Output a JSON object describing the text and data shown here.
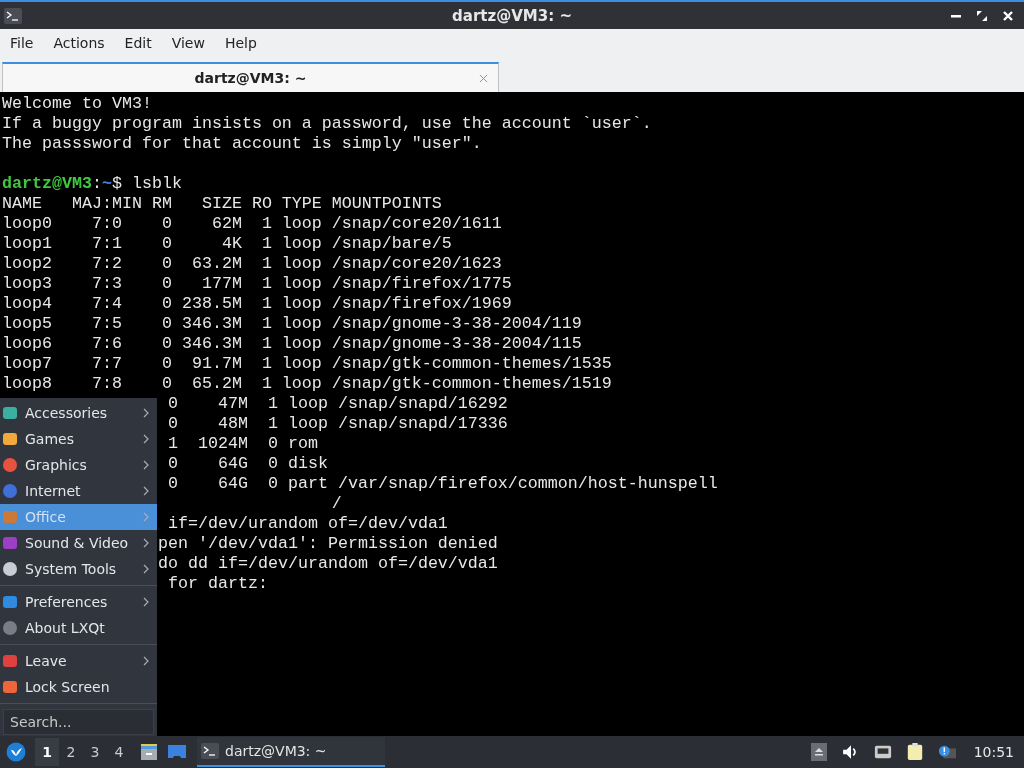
{
  "window": {
    "title": "dartz@VM3: ~"
  },
  "menubar": [
    "File",
    "Actions",
    "Edit",
    "View",
    "Help"
  ],
  "tabs": [
    {
      "label": "dartz@VM3: ~",
      "selected": true
    }
  ],
  "terminal": {
    "lines": [
      {
        "kind": "text",
        "text": "Welcome to VM3!"
      },
      {
        "kind": "text",
        "text": "If a buggy program insists on a password, use the account `user`."
      },
      {
        "kind": "text",
        "text": "The passsword for that account is simply \"user\"."
      },
      {
        "kind": "blank"
      },
      {
        "kind": "prompt",
        "user": "dartz@VM3",
        "separator": ":",
        "path": "~",
        "symbol": "$",
        "command": "lsblk"
      },
      {
        "kind": "text",
        "text": "NAME   MAJ:MIN RM   SIZE RO TYPE MOUNTPOINTS"
      },
      {
        "kind": "text",
        "text": "loop0    7:0    0    62M  1 loop /snap/core20/1611"
      },
      {
        "kind": "text",
        "text": "loop1    7:1    0     4K  1 loop /snap/bare/5"
      },
      {
        "kind": "text",
        "text": "loop2    7:2    0  63.2M  1 loop /snap/core20/1623"
      },
      {
        "kind": "text",
        "text": "loop3    7:3    0   177M  1 loop /snap/firefox/1775"
      },
      {
        "kind": "text",
        "text": "loop4    7:4    0 238.5M  1 loop /snap/firefox/1969"
      },
      {
        "kind": "text",
        "text": "loop5    7:5    0 346.3M  1 loop /snap/gnome-3-38-2004/119"
      },
      {
        "kind": "text",
        "text": "loop6    7:6    0 346.3M  1 loop /snap/gnome-3-38-2004/115"
      },
      {
        "kind": "text",
        "text": "loop7    7:7    0  91.7M  1 loop /snap/gtk-common-themes/1535"
      },
      {
        "kind": "text",
        "text": "loop8    7:8    0  65.2M  1 loop /snap/gtk-common-themes/1519"
      },
      {
        "kind": "covered",
        "text": " 0    47M  1 loop /snap/snapd/16292"
      },
      {
        "kind": "covered",
        "text": " 0    48M  1 loop /snap/snapd/17336"
      },
      {
        "kind": "covered",
        "text": " 1  1024M  0 rom"
      },
      {
        "kind": "covered",
        "text": " 0    64G  0 disk"
      },
      {
        "kind": "covered",
        "text": " 0    64G  0 part /var/snap/firefox/common/host-hunspell"
      },
      {
        "kind": "text",
        "text": "                                 /"
      },
      {
        "kind": "covered",
        "text": " if=/dev/urandom of=/dev/vda1"
      },
      {
        "kind": "covered",
        "text": "pen '/dev/vda1': Permission denied"
      },
      {
        "kind": "covered",
        "text": "do dd if=/dev/urandom of=/dev/vda1"
      },
      {
        "kind": "covered",
        "text": " for dartz:"
      }
    ]
  },
  "app_menu": {
    "sections": [
      {
        "items": [
          {
            "label": "Accessories",
            "submenu": true,
            "selected": false
          },
          {
            "label": "Games",
            "submenu": true,
            "selected": false
          },
          {
            "label": "Graphics",
            "submenu": true,
            "selected": false
          },
          {
            "label": "Internet",
            "submenu": true,
            "selected": false
          },
          {
            "label": "Office",
            "submenu": true,
            "selected": true
          },
          {
            "label": "Sound & Video",
            "submenu": true,
            "selected": false
          },
          {
            "label": "System Tools",
            "submenu": true,
            "selected": false
          }
        ]
      },
      {
        "items": [
          {
            "label": "Preferences",
            "submenu": true,
            "selected": false
          },
          {
            "label": "About LXQt",
            "submenu": false,
            "selected": false
          }
        ]
      },
      {
        "items": [
          {
            "label": "Leave",
            "submenu": true,
            "selected": false
          },
          {
            "label": "Lock Screen",
            "submenu": false,
            "selected": false
          }
        ]
      }
    ],
    "search": {
      "placeholder": "Search..."
    }
  },
  "taskbar": {
    "workspaces": [
      {
        "label": "1",
        "selected": true
      },
      {
        "label": "2",
        "selected": false
      },
      {
        "label": "3",
        "selected": false
      },
      {
        "label": "4",
        "selected": false
      }
    ],
    "tasks": [
      {
        "label": "dartz@VM3: ~",
        "selected": true
      }
    ],
    "clock": "10:51"
  }
}
